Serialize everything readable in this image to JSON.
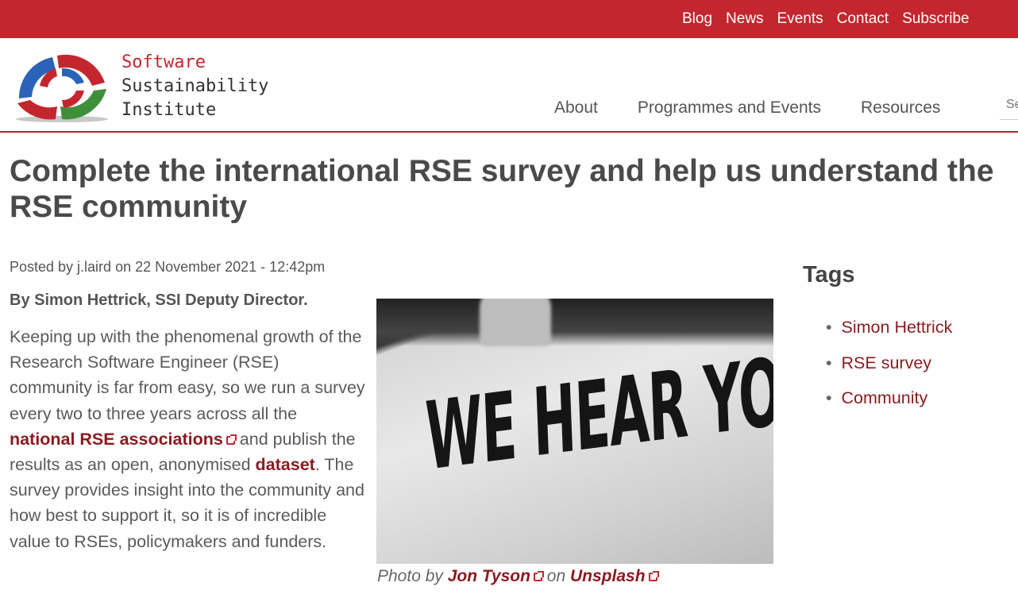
{
  "topnav": [
    "Blog",
    "News",
    "Events",
    "Contact",
    "Subscribe"
  ],
  "logo": {
    "line1": "Software",
    "line2": "Sustainability",
    "line3": "Institute"
  },
  "mainnav": [
    "About",
    "Programmes and Events",
    "Resources"
  ],
  "search": {
    "placeholder": "Se"
  },
  "article": {
    "title": "Complete the international RSE survey and help us understand the RSE community",
    "meta": "Posted by j.laird on 22 November 2021 - 12:42pm",
    "byline": "By Simon Hettrick, SSI Deputy Director.",
    "p1_a": "Keeping up with the phenomenal growth of the Research Software Engineer (RSE) community is far from easy, so we run a survey every two to three years across all the ",
    "link_associations": "national RSE associations",
    "p1_b": " and publish the results as an open, anonymised ",
    "link_dataset": "dataset",
    "p1_c": ". The survey provides insight into the community and how best to support it, so it is of incredible value to RSEs, policymakers and funders."
  },
  "photo": {
    "sign_text": "WE HEAR YOU.",
    "caption_prefix": "Photo by ",
    "caption_author": "Jon Tyson",
    "caption_mid": " on ",
    "caption_site": "Unsplash"
  },
  "tags": {
    "title": "Tags",
    "items": [
      "Simon Hettrick",
      "RSE survey",
      "Community"
    ]
  },
  "colors": {
    "brand_red": "#c4262e",
    "link_dark_red": "#8b1a1f"
  }
}
